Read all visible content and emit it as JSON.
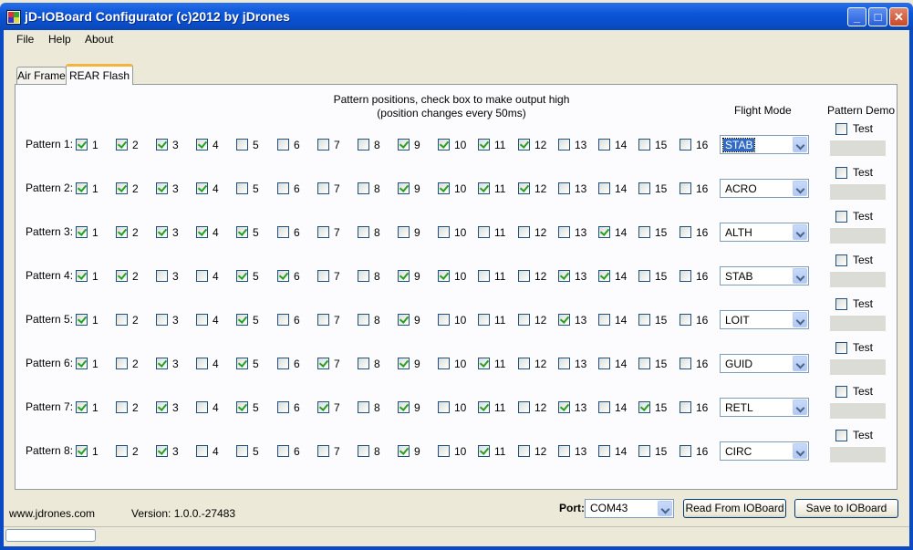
{
  "window": {
    "title": "jD-IOBoard Configurator (c)2012 by jDrones",
    "minimize_glyph": "_",
    "maximize_glyph": "□",
    "close_glyph": "✕"
  },
  "menu": [
    "File",
    "Help",
    "About"
  ],
  "tabs": [
    {
      "label": "Air Frame",
      "active": false
    },
    {
      "label": "REAR Flash",
      "active": true
    }
  ],
  "panel": {
    "heading_line1": "Pattern positions, check box to make output high",
    "heading_line2": "(position changes every 50ms)",
    "flight_mode_header": "Flight Mode",
    "pattern_demo_header": "Pattern Demo",
    "test_label": "Test",
    "patterns": [
      {
        "label": "Pattern 1:",
        "checked": [
          1,
          2,
          3,
          4,
          9,
          10,
          11,
          12
        ],
        "mode": "STAB",
        "mode_selected": true,
        "test": false
      },
      {
        "label": "Pattern 2:",
        "checked": [
          1,
          2,
          3,
          4,
          9,
          10,
          11,
          12
        ],
        "mode": "ACRO",
        "mode_selected": false,
        "test": false
      },
      {
        "label": "Pattern 3:",
        "checked": [
          1,
          2,
          3,
          4,
          5,
          14
        ],
        "mode": "ALTH",
        "mode_selected": false,
        "test": false
      },
      {
        "label": "Pattern 4:",
        "checked": [
          1,
          2,
          5,
          6,
          9,
          10,
          13,
          14
        ],
        "mode": "STAB",
        "mode_selected": false,
        "test": false
      },
      {
        "label": "Pattern 5:",
        "checked": [
          1,
          5,
          9,
          13
        ],
        "mode": "LOIT",
        "mode_selected": false,
        "test": false
      },
      {
        "label": "Pattern 6:",
        "checked": [
          1,
          3,
          5,
          7,
          9,
          11
        ],
        "mode": "GUID",
        "mode_selected": false,
        "test": false
      },
      {
        "label": "Pattern 7:",
        "checked": [
          1,
          3,
          5,
          7,
          9,
          11,
          13,
          15
        ],
        "mode": "RETL",
        "mode_selected": false,
        "test": false
      },
      {
        "label": "Pattern 8:",
        "checked": [
          1,
          3,
          9,
          11
        ],
        "mode": "CIRC",
        "mode_selected": false,
        "test": false
      }
    ]
  },
  "footer": {
    "website": "www.jdrones.com",
    "version": "Version:  1.0.0.-27483",
    "port_label": "Port:",
    "port_value": "COM43",
    "read_button": "Read From IOBoard",
    "save_button": "Save to IOBoard"
  },
  "colors": {
    "titlebar": "#0b56d8",
    "tab_highlight": "#f7b43a",
    "check": "#21a121",
    "selection": "#316ac5"
  }
}
